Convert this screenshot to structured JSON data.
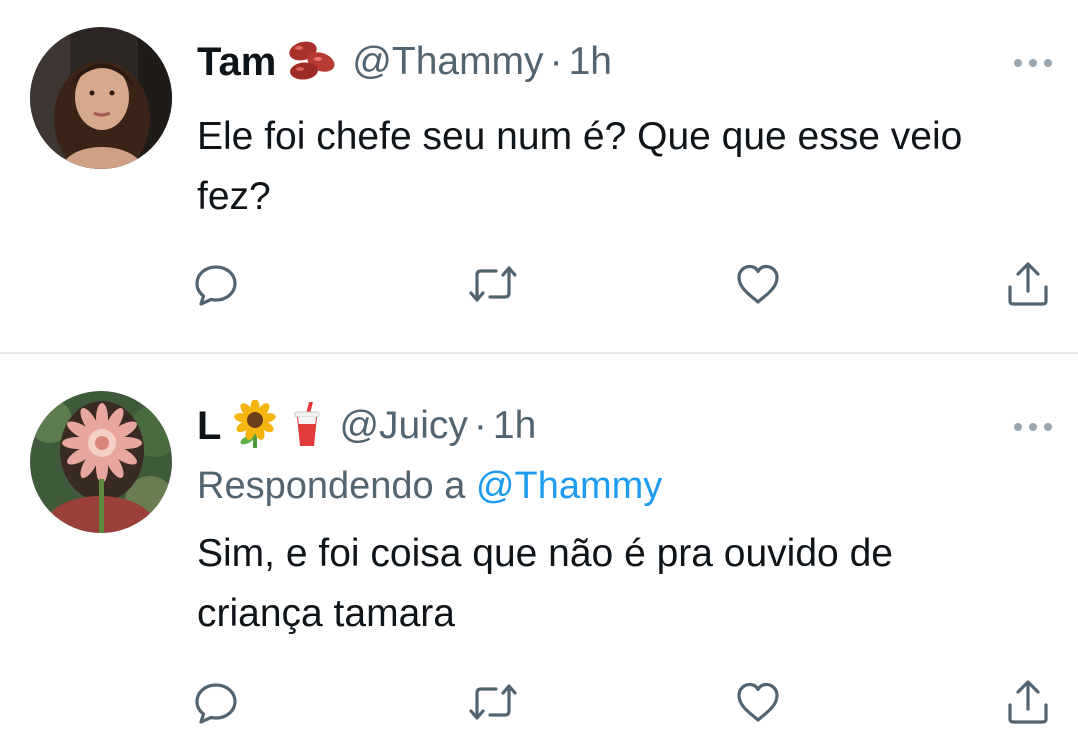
{
  "tweets": [
    {
      "display_name": "Tam",
      "name_emojis": [
        "beans-emoji"
      ],
      "handle": "@Thammy",
      "separator": "·",
      "time": "1h",
      "text": "Ele foi chefe seu num é? Que que esse veio fez?",
      "actions": [
        "reply-icon",
        "retweet-icon",
        "like-icon",
        "share-icon"
      ]
    },
    {
      "display_name": "L",
      "name_emojis": [
        "sunflower-emoji",
        "cup-with-straw-emoji"
      ],
      "handle": "@Juicy",
      "separator": "·",
      "time": "1h",
      "replying_prefix": "Respondendo a",
      "replying_to": "@Thammy",
      "text": "Sim, e foi coisa que não é pra ouvido de criança tamara",
      "actions": [
        "reply-icon",
        "retweet-icon",
        "like-icon",
        "share-icon"
      ]
    }
  ],
  "colors": {
    "text": "#0f1419",
    "secondary": "#536471",
    "link": "#1d9bf0",
    "divider": "#e6e9eb"
  }
}
